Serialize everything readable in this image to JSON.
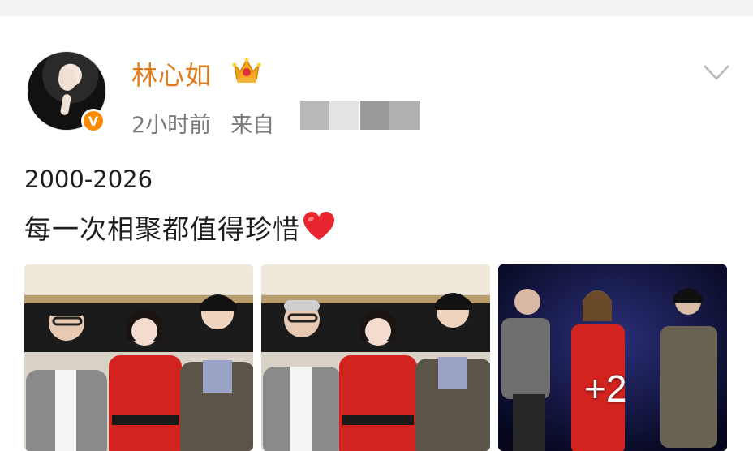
{
  "post": {
    "author": {
      "name": "林心如",
      "verified_badge": "V",
      "badge_color": "#ff8a00",
      "name_color": "#e07b1d",
      "vip_icon": "crown-icon"
    },
    "time": "2小时前",
    "source_prefix": "来自",
    "text_line1": "2000-2026",
    "text_line2": "每一次相聚都值得珍惜",
    "emoji": "heart-icon",
    "photos": {
      "more_count": "+2"
    },
    "menu_icon": "chevron-down-icon"
  }
}
